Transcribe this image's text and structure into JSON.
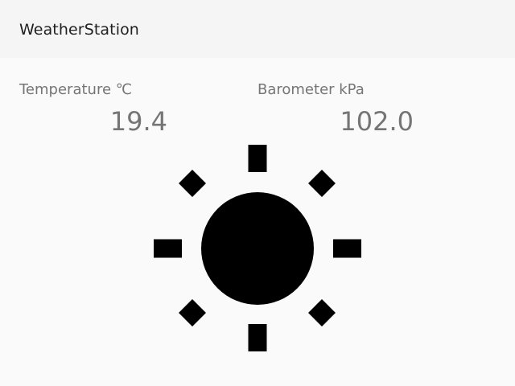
{
  "app_bar": {
    "title": "WeatherStation"
  },
  "readings": {
    "temperature": {
      "label": "Temperature ℃",
      "value": "19.4"
    },
    "barometer": {
      "label": "Barometer kPa",
      "value": "102.0"
    }
  },
  "weather": {
    "icon": "sun-icon",
    "color": "#000000"
  }
}
